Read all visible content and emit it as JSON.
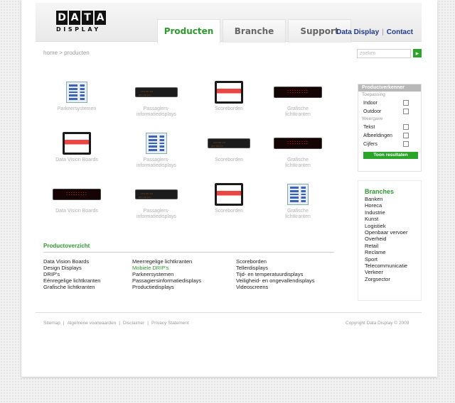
{
  "logo": {
    "letters": [
      "D",
      "A",
      "T",
      "A"
    ],
    "subtitle": "DISPLAY"
  },
  "nav": {
    "tabs": [
      {
        "label": "Producten",
        "active": true
      },
      {
        "label": "Branche",
        "active": false
      },
      {
        "label": "Support",
        "active": false
      }
    ],
    "right_links": [
      "Data Display",
      "Contact"
    ]
  },
  "breadcrumb": "home > producten",
  "search": {
    "placeholder": "zoeken",
    "button_icon": "arrow-right-icon"
  },
  "products": [
    {
      "label": "Parkeersystemen",
      "image": "parking-display"
    },
    {
      "label": "Passagiers-\ninformatiedisplays",
      "image": "orange-led-display"
    },
    {
      "label": "Scoreborden",
      "image": "scoreboard"
    },
    {
      "label": "Grafische\nlichtkranten",
      "image": "red-led-display"
    },
    {
      "label": "Data Vision Boards",
      "image": "scoreboard"
    },
    {
      "label": "Passagiers-\ninformatiedisplays",
      "image": "parking-display"
    },
    {
      "label": "Scoreborden",
      "image": "orange-led-display"
    },
    {
      "label": "Grafische\nlichtkranten",
      "image": "red-led-display"
    },
    {
      "label": "Data Vision Boards",
      "image": "red-led-display"
    },
    {
      "label": "Passagiers-\ninformatiedisplays",
      "image": "orange-led-display"
    },
    {
      "label": "Scoreborden",
      "image": "scoreboard"
    },
    {
      "label": "Grafische\nlichtkranten",
      "image": "parking-display"
    }
  ],
  "overview": {
    "title": "Productoverzicht",
    "columns": [
      [
        "Data Vision Boards",
        "Design Displays",
        "DRIP's",
        "Eénregelige lichtkranten",
        "Grafische lichtkranten"
      ],
      [
        "Meerregelige lichtkranten",
        "Mobiele DRIP's",
        "Parkeersystemen",
        "Passagiersinformatiedisplays",
        "Productiedisplays"
      ],
      [
        "Scoreborden",
        "Tellerdisplays",
        "Tijd- en temperatuurdisplays",
        "Veiligheid- en ongevallendisplays",
        "Videoscreens"
      ]
    ],
    "highlighted": "Mobiele DRIP's"
  },
  "filter": {
    "title": "Productverkenner",
    "groups": [
      {
        "label": "Toepassing",
        "options": [
          "Indoor",
          "Outdoor"
        ]
      },
      {
        "label": "Weergave",
        "options": [
          "Tekst",
          "Afbeeldingen",
          "Cijfers"
        ]
      }
    ],
    "button": "Toon resultaten"
  },
  "branches": {
    "title": "Branches",
    "items": [
      "Banken",
      "Horeca",
      "Industrie",
      "Kunst",
      "Logistiek",
      "Openbaar vervoer",
      "Overheid",
      "Retail",
      "Reclame",
      "Sport",
      "Telecommunicatie",
      "Verkeer",
      "Zorgsector"
    ]
  },
  "footer": {
    "links": [
      "Sitemap",
      "Algemene voorwaarden",
      "Disclaimer",
      "Privacy Statement"
    ],
    "copyright": "Copyright Data Display © 2009"
  },
  "colors": {
    "accent_green": "#2d9b2d",
    "link_blue": "#1f3a8a"
  }
}
